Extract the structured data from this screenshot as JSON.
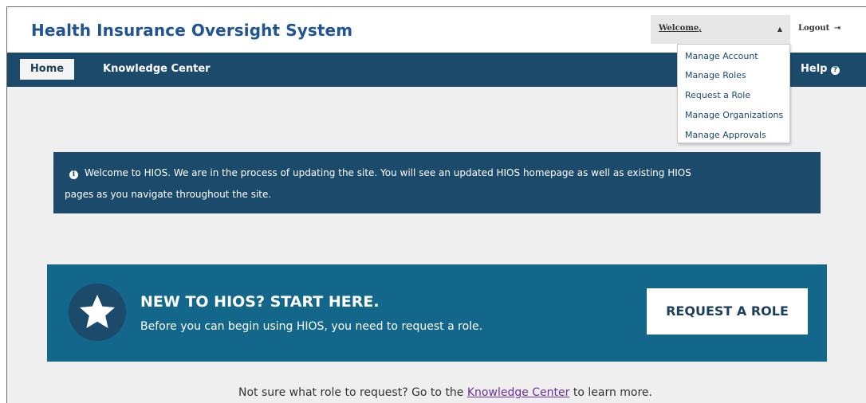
{
  "header": {
    "site_title": "Health Insurance Oversight System",
    "welcome_label": "Welcome,",
    "welcome_caret": "▲",
    "logout_label": "Logout",
    "logout_icon": "⇥"
  },
  "navbar": {
    "home_label": "Home",
    "knowledge_center_label": "Knowledge Center",
    "help_label": "Help",
    "help_icon": "?"
  },
  "dropdown": {
    "items": [
      {
        "label": "Manage Account"
      },
      {
        "label": "Manage Roles"
      },
      {
        "label": "Request a Role"
      },
      {
        "label": "Manage Organizations"
      },
      {
        "label": "Manage Approvals"
      }
    ]
  },
  "notice": {
    "icon": "i",
    "line1": "Welcome to HIOS. We are in the process of updating the site. You will see an updated HIOS homepage as well as existing HIOS",
    "line2": "pages as you navigate throughout the site."
  },
  "banner": {
    "heading": "NEW TO HIOS? START HERE.",
    "subtext": "Before you can begin using HIOS, you need to request a role.",
    "button_label": "REQUEST A ROLE"
  },
  "footer": {
    "prefix": "Not sure what role to request? Go to the ",
    "link_text": "Knowledge Center",
    "suffix": " to learn more."
  },
  "colors": {
    "title_blue": "#205493",
    "navbar_dark": "#1c4a6b",
    "banner_teal": "#13678a",
    "page_bg": "#efefef",
    "link_purple": "#6b2fa3"
  }
}
